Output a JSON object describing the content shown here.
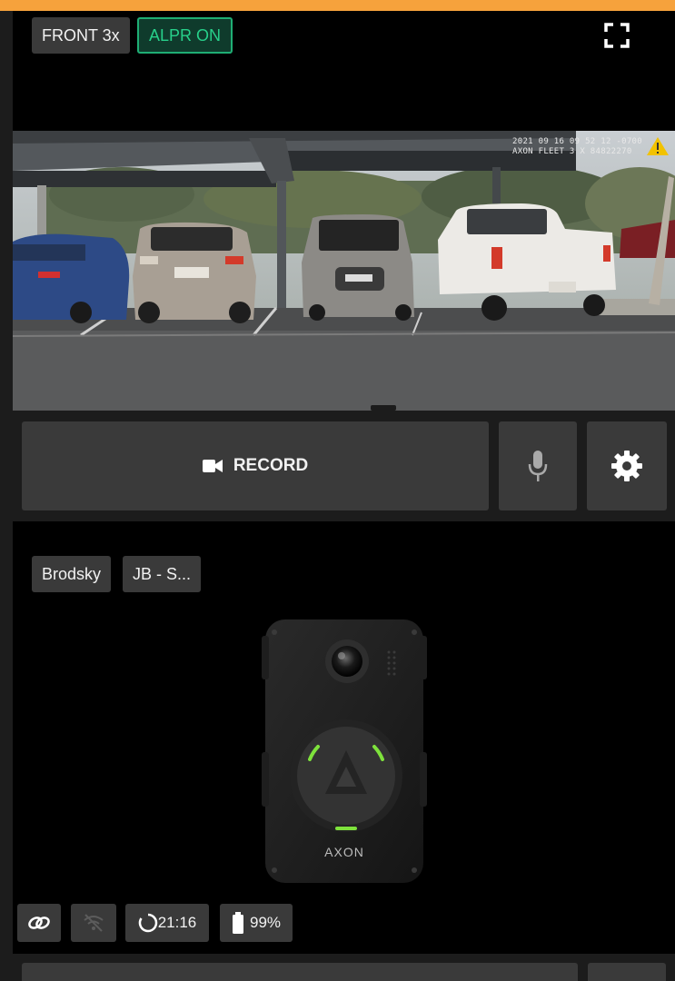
{
  "header": {
    "camera_label": "FRONT 3x",
    "alpr_label": "ALPR ON"
  },
  "camera": {
    "overlay_line1": "2021 09 16 09 52 12 -0700",
    "overlay_line2": "AXON FLEET 3 X 84822270"
  },
  "controls": {
    "record_label": "RECORD"
  },
  "device": {
    "officer_tag": "Brodsky",
    "unit_tag": "JB - S...",
    "brand_text": "AXON"
  },
  "status": {
    "timer": "21:16",
    "battery": "99%"
  },
  "colors": {
    "accent": "#f6a23c",
    "alpr_green": "#27d08a",
    "button_bg": "#3a3a3a",
    "panel_bg": "#1c1c1c"
  }
}
